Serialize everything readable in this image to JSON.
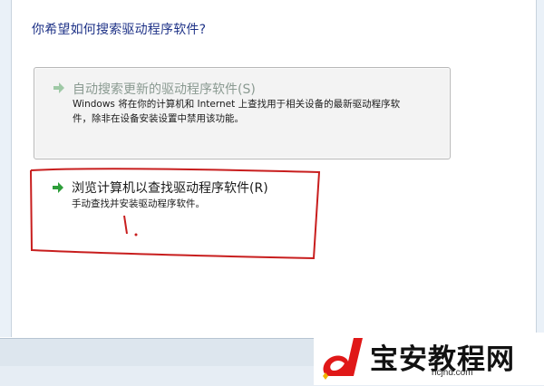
{
  "dialog": {
    "question": "你希望如何搜索驱动程序软件?",
    "options": [
      {
        "title": "自动搜索更新的驱动程序软件(S)",
        "desc_line1": "Windows 将在你的计算机和 Internet 上查找用于相关设备的最新驱动程序软",
        "desc_line2": "件，除非在设备安装设置中禁用该功能。",
        "state": "disabled"
      },
      {
        "title": "浏览计算机以查找驱动程序软件(R)",
        "desc_line1": "手动查找并安装驱动程序软件。",
        "state": "enabled"
      }
    ]
  },
  "watermark": {
    "name": "宝安教程网",
    "url": "hcjhd.com"
  },
  "colors": {
    "question": "#1e3287",
    "arrow": "#2e9e3a",
    "annotation": "#c81e1e",
    "watermark_red": "#e01818"
  },
  "icons": [
    "green-arrow-icon",
    "watermark-logo-icon"
  ]
}
